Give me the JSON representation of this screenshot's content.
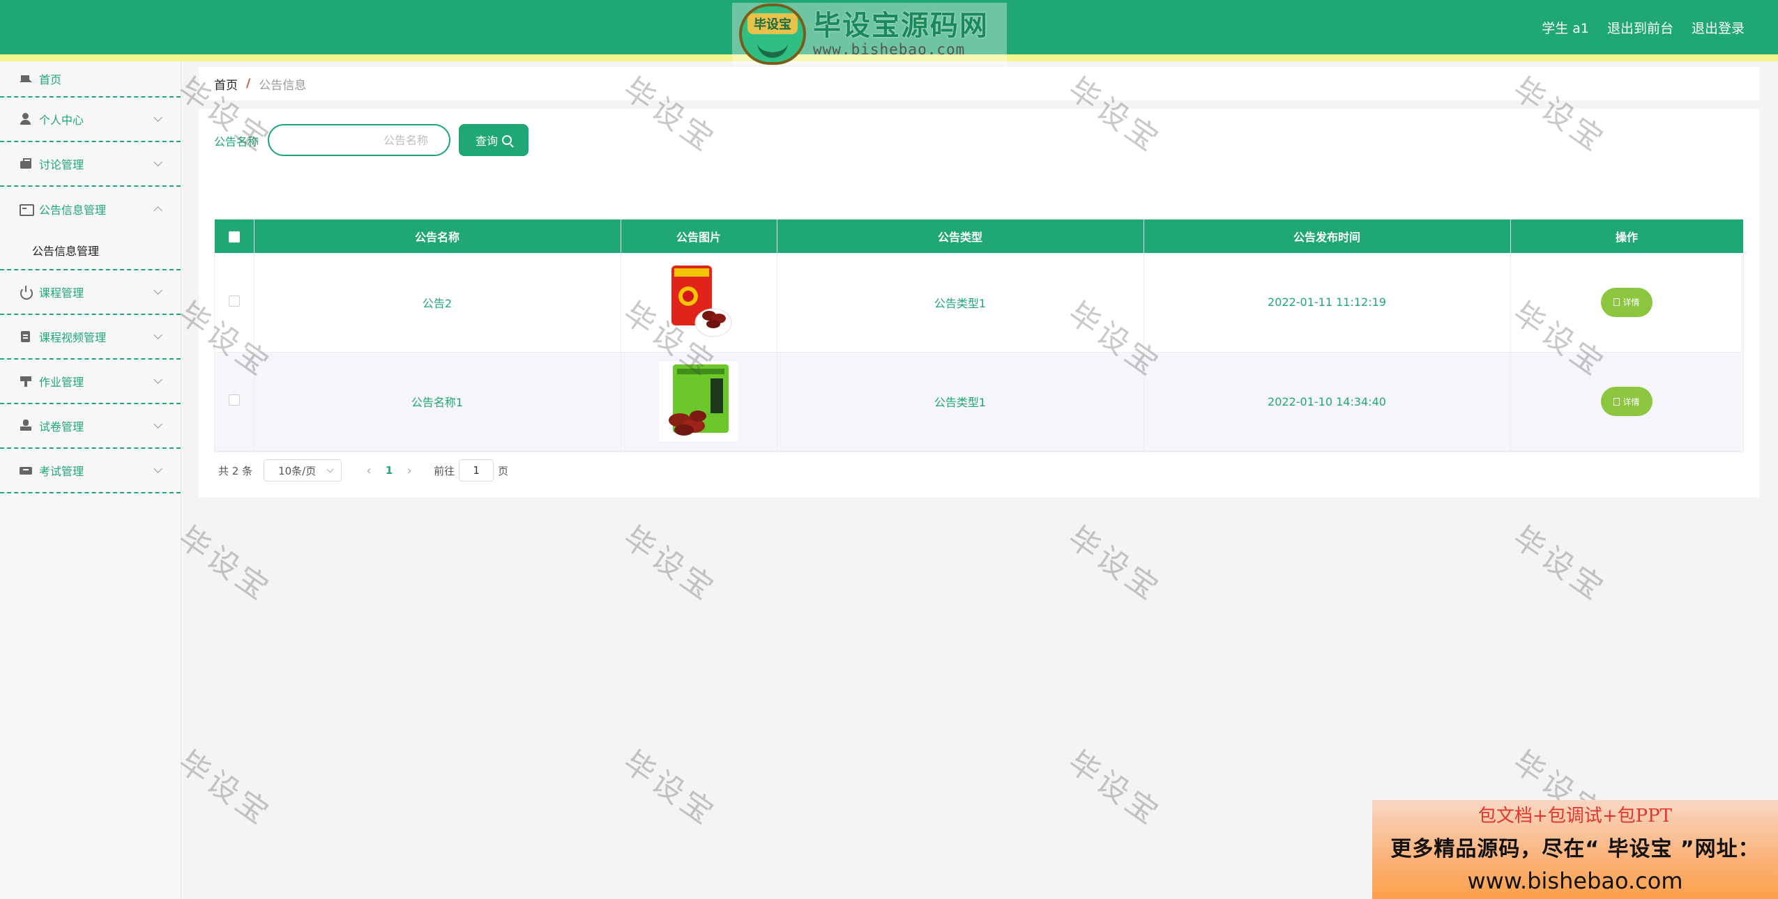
{
  "header": {
    "brand_badge": "毕设宝",
    "brand_title": "毕设宝源码网",
    "brand_url": "www.bishebao.com",
    "colors": {
      "primary": "#1fa774",
      "accent_strip": "#f3f58b"
    },
    "links": [
      "学生 a1",
      "退出到前台",
      "退出登录"
    ]
  },
  "sidebar": {
    "home": {
      "label": "首页",
      "icon": "home-icon"
    },
    "items": [
      {
        "label": "个人中心",
        "icon": "user-icon",
        "expanded": false
      },
      {
        "label": "讨论管理",
        "icon": "briefcase-icon",
        "expanded": false
      },
      {
        "label": "公告信息管理",
        "icon": "card-icon",
        "expanded": true,
        "sub": [
          "公告信息管理"
        ]
      },
      {
        "label": "课程管理",
        "icon": "power-icon",
        "expanded": false
      },
      {
        "label": "课程视频管理",
        "icon": "clipboard-icon",
        "expanded": false
      },
      {
        "label": "作业管理",
        "icon": "hammer-icon",
        "expanded": false
      },
      {
        "label": "试卷管理",
        "icon": "stamp-icon",
        "expanded": false
      },
      {
        "label": "考试管理",
        "icon": "ticket-icon",
        "expanded": false
      }
    ]
  },
  "breadcrumb": {
    "home": "首页",
    "sep": "/",
    "current": "公告信息"
  },
  "search": {
    "label": "公告名称",
    "placeholder": "公告名称",
    "value": "",
    "button": "查询"
  },
  "table": {
    "headers": [
      "公告名称",
      "公告图片",
      "公告类型",
      "公告发布时间",
      "操作"
    ],
    "rows": [
      {
        "name": "公告2",
        "image": "red-jujube-package",
        "type": "公告类型1",
        "time": "2022-01-11 11:12:19",
        "action": "详情"
      },
      {
        "name": "公告名称1",
        "image": "green-jujube-package",
        "type": "公告类型1",
        "time": "2022-01-10 14:34:40",
        "action": "详情"
      }
    ]
  },
  "pagination": {
    "total": "共 2 条",
    "page_size": "10条/页",
    "prev": "‹",
    "current": "1",
    "next": "›",
    "goto_label": "前往",
    "goto_value": "1",
    "page_suffix": "页"
  },
  "watermark": "毕设宝",
  "promo": {
    "line1": "包文档+包调试+包PPT",
    "line2": "更多精品源码，尽在“ 毕设宝 ”网址：",
    "line3": "www.bishebao.com"
  }
}
